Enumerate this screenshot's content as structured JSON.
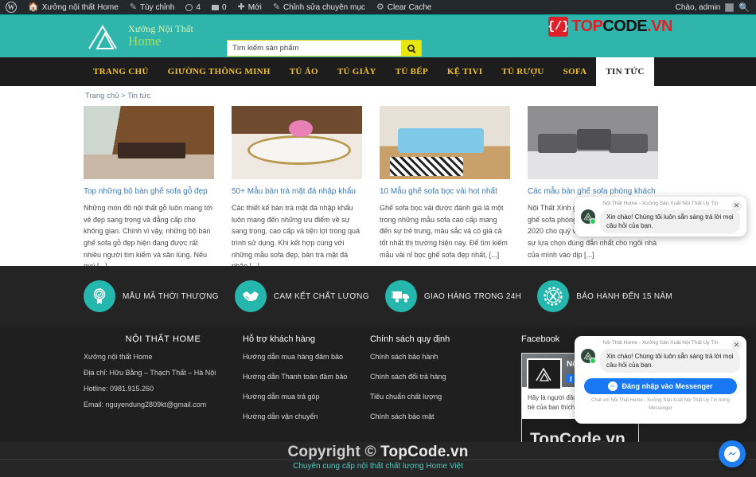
{
  "adminbar": {
    "logo_icon": "wordpress-icon",
    "items": [
      {
        "icon": "home-icon",
        "label": "Xưởng nội thất Home"
      },
      {
        "icon": "pencil-icon",
        "label": "Tùy chỉnh"
      },
      {
        "icon": "refresh-icon",
        "label": "4"
      },
      {
        "icon": "comment-icon",
        "label": "0"
      },
      {
        "icon": "plus-icon",
        "label": "Mới"
      },
      {
        "icon": "edit-icon",
        "label": "Chỉnh sửa chuyên mục"
      },
      {
        "icon": "cache-icon",
        "label": "Clear Cache"
      }
    ],
    "greeting": "Chào, admin",
    "avatar_icon": "avatar-icon",
    "search_icon": "search-icon"
  },
  "header": {
    "logo_icon": "mountain-logo-icon",
    "logo_line1": "Xưởng Nội Thất",
    "logo_line2": "Home",
    "search": {
      "value": "Tìm kiếm sản phẩm",
      "placeholder": "Tìm kiếm sản phẩm",
      "button_icon": "search-icon"
    },
    "topcode": {
      "badge": "{/}",
      "part1": "TOP",
      "part2": "CODE",
      "part3": ".VN"
    },
    "colors": {
      "teal": "#2fb5ab",
      "yellow": "#e8e80f",
      "red": "#e02028"
    }
  },
  "nav": {
    "items": [
      {
        "label": "TRANG CHỦ",
        "active": false
      },
      {
        "label": "GIƯỜNG THÔNG MINH",
        "active": false
      },
      {
        "label": "TỦ ÁO",
        "active": false
      },
      {
        "label": "TỦ GIÀY",
        "active": false
      },
      {
        "label": "TỦ BẾP",
        "active": false
      },
      {
        "label": "KỆ TIVI",
        "active": false
      },
      {
        "label": "TỦ RƯỢU",
        "active": false
      },
      {
        "label": "SOFA",
        "active": false
      },
      {
        "label": "TIN TỨC",
        "active": true
      }
    ],
    "accent_color": "#f2c12e"
  },
  "main": {
    "breadcrumb": "Trang chủ > Tin tức",
    "posts": [
      {
        "thumb": "living-room-wood-sofa-photo",
        "title": "Top những bộ bàn ghế sofa gỗ đẹp",
        "excerpt": "Những món đồ nội thất gỗ luôn mang tới vẻ đẹp sang trọng và đẳng cấp cho không gian. Chính vì vậy, những bộ bàn ghế sofa gỗ đẹp hiện đang được rất nhiều người tìm kiếm và săn lùng. Nếu quý [...]"
      },
      {
        "thumb": "marble-tea-table-photo",
        "title": "50+ Mẫu bàn trà mặt đá nhập khẩu",
        "excerpt": "Các thiết kế bàn trà mặt đá nhập khẩu luôn mang đến những ưu điểm về sự sang trọng, cao cấp và tiện lợi trong quá trình sử dụng. Khi kết hợp cùng với những mẫu sofa đẹp, bàn trà mặt đá nhập [...]"
      },
      {
        "thumb": "blue-fabric-sofa-photo",
        "title": "10 Mẫu ghế sofa bọc vải hot nhất",
        "excerpt": "Ghế sofa bọc vải được đánh giá là một trong những mẫu sofa cao cấp mang đến sự trẻ trung, màu sắc và có giá cả tốt nhất thị trường hiện nay. Để tìm kiếm mẫu vải nỉ bọc ghế sofa đẹp nhất, [...]"
      },
      {
        "thumb": "grey-leather-sofa-set-photo",
        "title": "Các mẫu bàn ghế sofa phòng khách",
        "excerpt": "Nội Thất Xinh giới thiệu các mẫu bàn ghế sofa phòng khách đẹp nhất năm 2020 cho quý vị. Hãy liên hệ ngay để có sự lựa chọn đúng đắn nhất cho ngôi nhà của mình vào dịp [...]"
      }
    ]
  },
  "features": {
    "items": [
      {
        "icon": "badge-check-icon",
        "label": "MẪU MÃ THỜI THƯỢNG"
      },
      {
        "icon": "handshake-icon",
        "label": "CAM KẾT CHẤT LƯỢNG"
      },
      {
        "icon": "truck-icon",
        "label": "GIAO HÀNG TRONG 24H"
      },
      {
        "icon": "gear-wrench-icon",
        "label": "BẢO HÀNH ĐẾN 15 NĂM"
      }
    ],
    "accent_color": "#25b7ad"
  },
  "footer": {
    "col1": {
      "title": "NỘI THẤT HOME",
      "lines": [
        "Xưởng nội thất Home",
        "Địa chỉ: Hữu Bằng – Thạch Thất – Hà Nội",
        "Hotline: 0981.915.260",
        "Email: nguyendung2809kt@gmail.com"
      ]
    },
    "col2": {
      "title": "Hỗ trợ khách hàng",
      "links": [
        "Hướng dẫn mua hàng đảm bảo",
        "Hướng dẫn Thanh toán đảm bảo",
        "Hướng dẫn mua trả góp",
        "Hướng dẫn vận chuyển"
      ]
    },
    "col3": {
      "title": "Chính sách quy định",
      "links": [
        "Chính sách bảo hành",
        "Chính sách đổi trả hàng",
        "Tiêu chuẩn chất lượng",
        "Chính sách bảo mật"
      ]
    },
    "col4": {
      "title": "Facebook",
      "page_name": "Nội Thất Home",
      "like_label": "Thích",
      "body_text": "Hãy là người đầu tiên trong số bạn bè của bạn thích nội dung này"
    }
  },
  "bottom": {
    "copyright_prefix": "Copyright © ",
    "copyright_brand": "TopCode.vn",
    "tagline": "Chuyên cung cấp nội thất chất lượng Home Việt",
    "watermark": "TopCode.vn"
  },
  "messenger": {
    "popup1": {
      "header": "Nội Thất Home - Xưởng Sản Xuất Nội Thất Uy Tín",
      "message": "Xin chào! Chúng tôi luôn sẵn sàng trả lời mọi câu hỏi của bạn.",
      "close_icon": "close-icon",
      "avatar_icon": "page-avatar-icon"
    },
    "popup2": {
      "header": "Nội Thất Home - Xưởng Sản Xuất Nội Thất Uy Tín",
      "message": "Xin chào! Chúng tôi luôn sẵn sàng trả lời mọi câu hỏi của bạn.",
      "button_label": "Đăng nhập vào Messenger",
      "button_icon": "messenger-icon",
      "footer": "Chat với Nội Thất Home - Xưởng Sản Xuất Nội Thất Uy Tín trong Messenger",
      "close_icon": "close-icon",
      "avatar_icon": "page-avatar-icon"
    },
    "fab_icon": "messenger-icon",
    "brand_color": "#1877f2"
  }
}
